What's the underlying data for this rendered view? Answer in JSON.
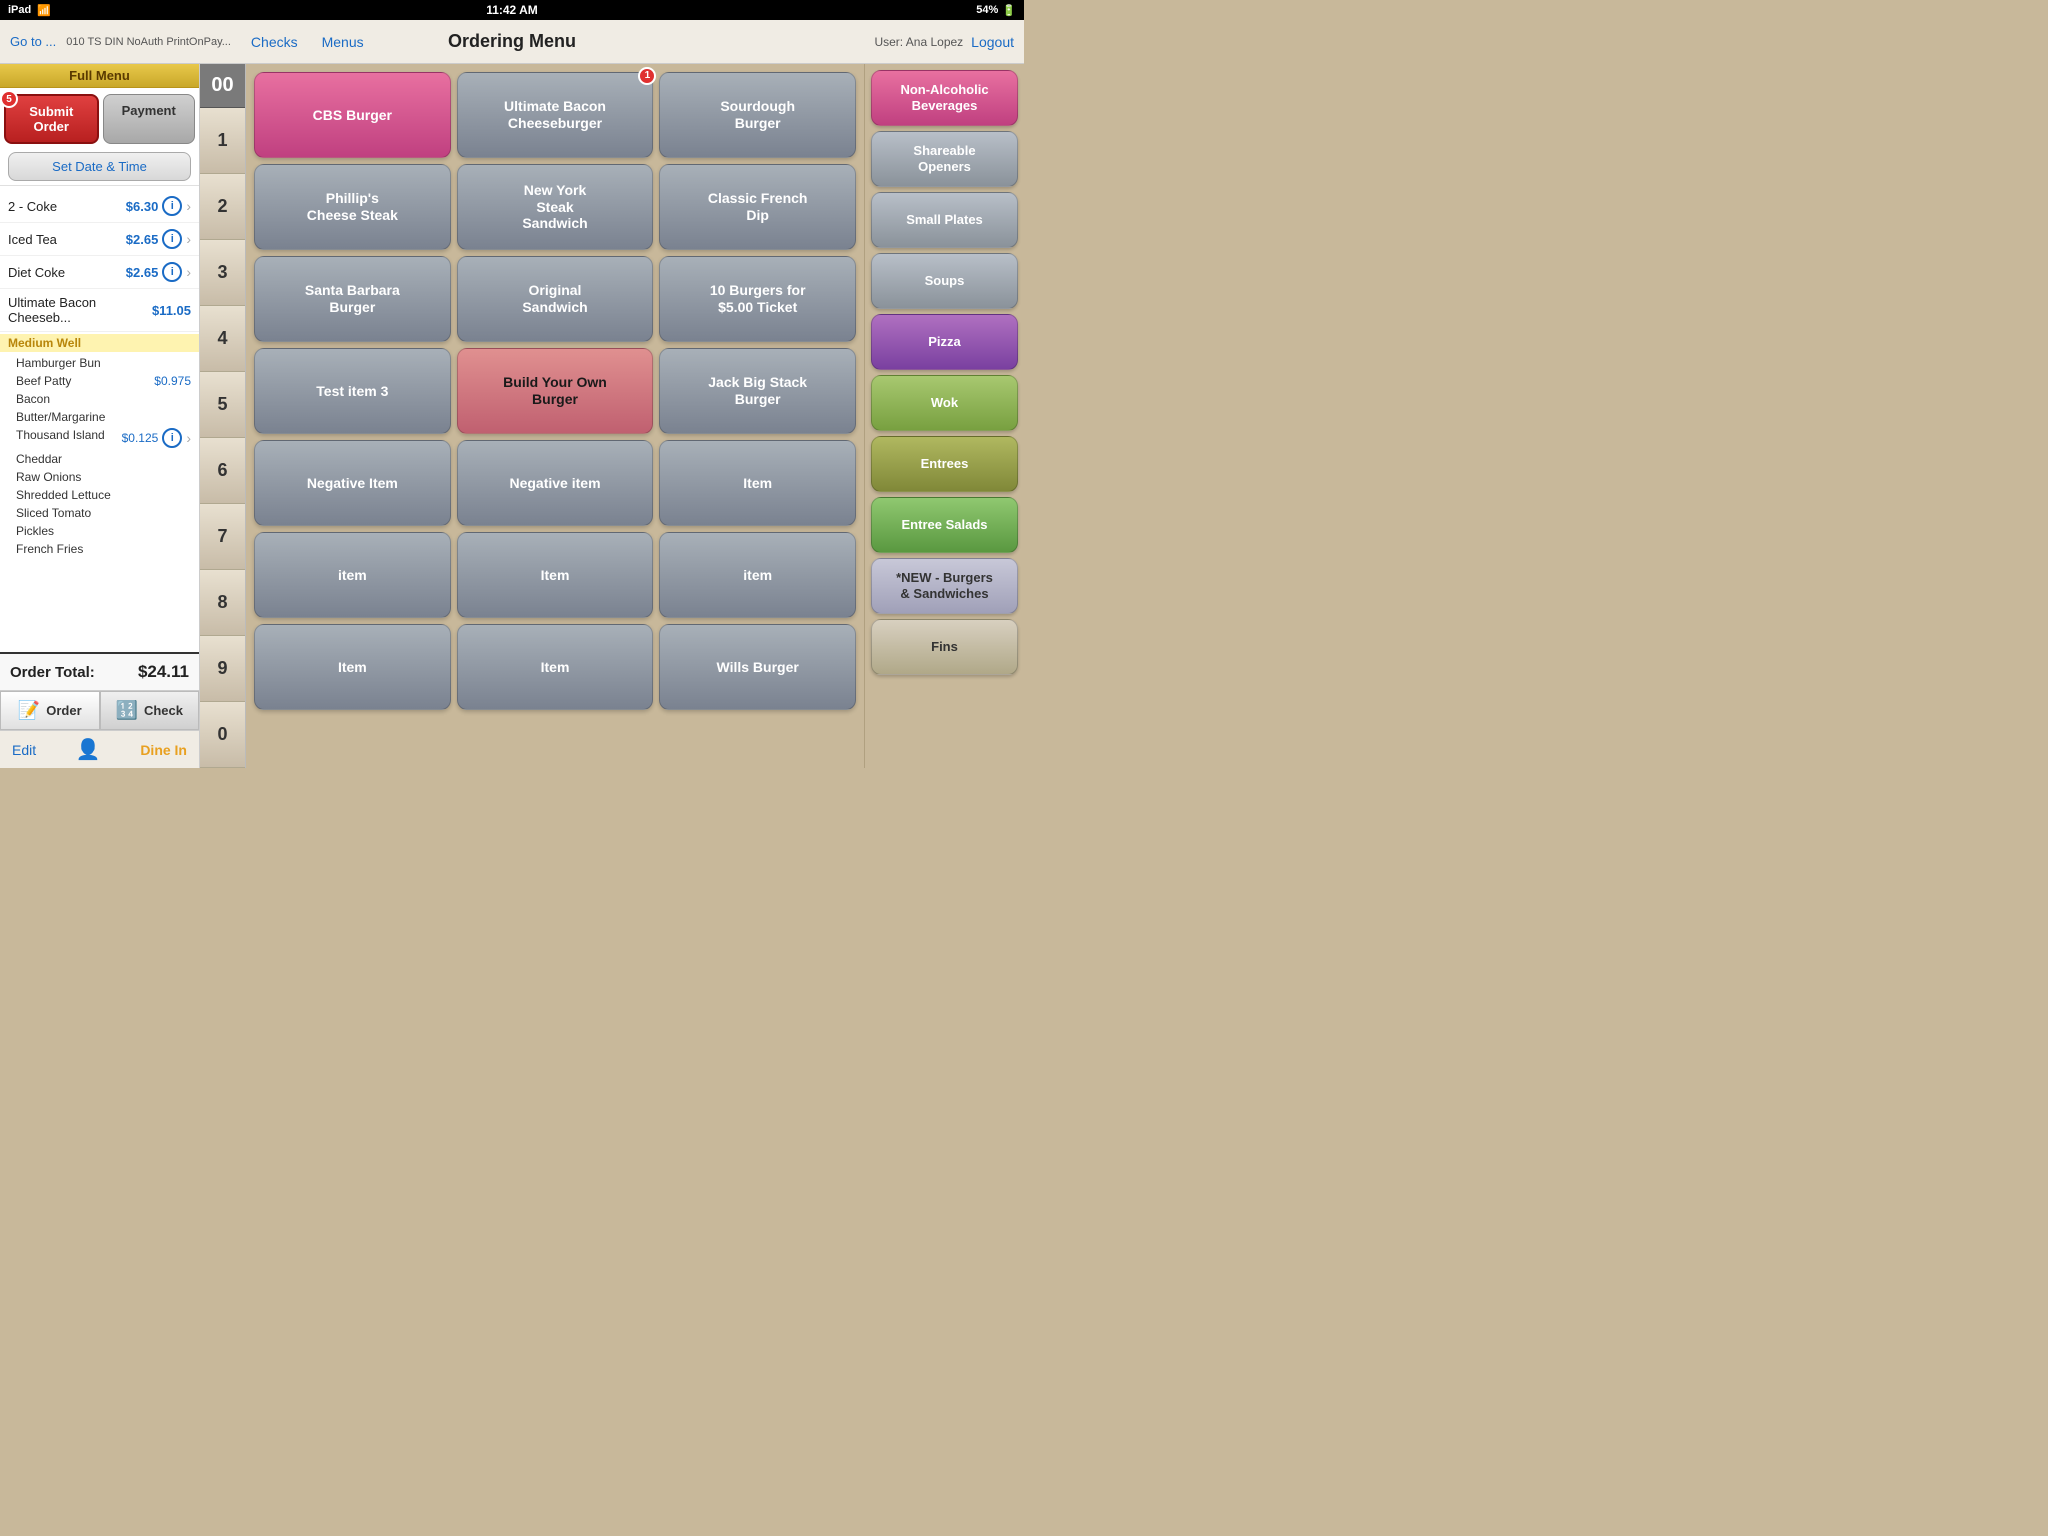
{
  "statusBar": {
    "left": "iPad",
    "wifi": "WiFi",
    "time": "11:42 AM",
    "battery": "54%"
  },
  "topNav": {
    "goto": "Go to ...",
    "info": "010 TS DIN NoAuth PrintOnPay...",
    "checks": "Checks",
    "menus": "Menus",
    "title": "Ordering Menu",
    "user": "User: Ana Lopez",
    "logout": "Logout"
  },
  "leftPanel": {
    "header": "Full Menu",
    "submitOrder": "Submit Order",
    "submitBadge": "5",
    "payment": "Payment",
    "setDateTime": "Set Date & Time",
    "orderItems": [
      {
        "name": "2 - Coke",
        "price": "$6.30"
      },
      {
        "name": "Iced Tea",
        "price": "$2.65"
      },
      {
        "name": "Diet Coke",
        "price": "$2.65"
      },
      {
        "name": "Ultimate Bacon Cheeseb...",
        "price": "$11.05"
      }
    ],
    "modifierLabel": "Medium Well",
    "modifiers": [
      {
        "name": "Hamburger Bun",
        "price": ""
      },
      {
        "name": "Beef Patty",
        "price": "$0.975"
      },
      {
        "name": "Bacon",
        "price": ""
      },
      {
        "name": "Butter/Margarine",
        "price": ""
      },
      {
        "name": "Thousand Island",
        "price": "$0.125"
      },
      {
        "name": "Cheddar",
        "price": ""
      },
      {
        "name": "Raw Onions",
        "price": ""
      },
      {
        "name": "Shredded Lettuce",
        "price": ""
      },
      {
        "name": "Sliced Tomato",
        "price": ""
      },
      {
        "name": "Pickles",
        "price": ""
      },
      {
        "name": "French Fries",
        "price": ""
      }
    ],
    "orderTotalLabel": "Order Total:",
    "orderTotal": "$24.11",
    "orderTabLabel": "Order",
    "checkTabLabel": "Check",
    "editLabel": "Edit",
    "dineInLabel": "Dine In"
  },
  "numpad": {
    "display": "00",
    "keys": [
      "1",
      "2",
      "3",
      "4",
      "5",
      "6",
      "7",
      "8",
      "9",
      "0"
    ]
  },
  "menuGrid": {
    "rows": [
      [
        {
          "label": "CBS Burger",
          "style": "pink",
          "badge": ""
        },
        {
          "label": "Ultimate Bacon\nCheeseburger",
          "style": "gray",
          "badge": "1"
        },
        {
          "label": "Sourdough\nBurger",
          "style": "gray",
          "badge": ""
        }
      ],
      [
        {
          "label": "Phillip's\nCheese Steak",
          "style": "gray",
          "badge": ""
        },
        {
          "label": "New York\nSteak\nSandwich",
          "style": "gray",
          "badge": ""
        },
        {
          "label": "Classic French\nDip",
          "style": "gray",
          "badge": ""
        }
      ],
      [
        {
          "label": "Santa Barbara\nBurger",
          "style": "gray",
          "badge": ""
        },
        {
          "label": "Original\nSandwich",
          "style": "gray",
          "badge": ""
        },
        {
          "label": "10 Burgers for\n$5.00 Ticket",
          "style": "gray",
          "badge": ""
        }
      ],
      [
        {
          "label": "Test item 3",
          "style": "gray",
          "badge": ""
        },
        {
          "label": "Build Your Own\nBurger",
          "style": "pink-light",
          "badge": ""
        },
        {
          "label": "Jack Big Stack\nBurger",
          "style": "gray",
          "badge": ""
        }
      ],
      [
        {
          "label": "Negative Item",
          "style": "gray",
          "badge": ""
        },
        {
          "label": "Negative item",
          "style": "gray",
          "badge": ""
        },
        {
          "label": "Item",
          "style": "gray",
          "badge": ""
        }
      ],
      [
        {
          "label": "item",
          "style": "gray",
          "badge": ""
        },
        {
          "label": "Item",
          "style": "gray",
          "badge": ""
        },
        {
          "label": "item",
          "style": "gray",
          "badge": ""
        }
      ],
      [
        {
          "label": "Item",
          "style": "gray",
          "badge": ""
        },
        {
          "label": "Item",
          "style": "gray",
          "badge": ""
        },
        {
          "label": "Wills Burger",
          "style": "gray",
          "badge": ""
        }
      ]
    ]
  },
  "categories": [
    {
      "label": "Non-Alcoholic\nBeverages",
      "style": "pink"
    },
    {
      "label": "Shareable\nOpeners",
      "style": "gray"
    },
    {
      "label": "Small Plates",
      "style": "gray"
    },
    {
      "label": "Soups",
      "style": "gray"
    },
    {
      "label": "Pizza",
      "style": "purple"
    },
    {
      "label": "Wok",
      "style": "light-green"
    },
    {
      "label": "Entrees",
      "style": "olive"
    },
    {
      "label": "Entree Salads",
      "style": "green"
    },
    {
      "label": "*NEW - Burgers\n& Sandwiches",
      "style": "new-burgers"
    },
    {
      "label": "Fins",
      "style": "fins"
    }
  ]
}
